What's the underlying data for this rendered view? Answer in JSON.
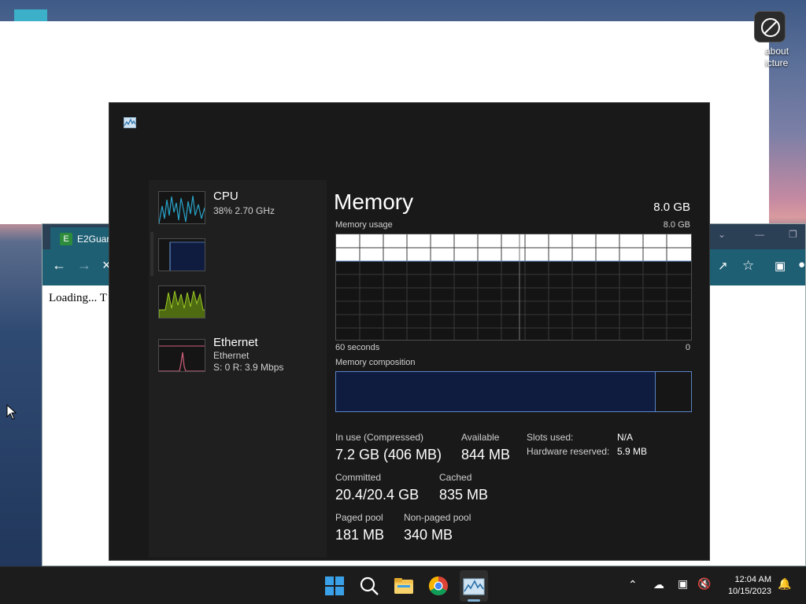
{
  "desktop": {
    "icon_label": "about\nicture"
  },
  "edge": {
    "tab_title": "E2Guar",
    "content_text": "Loading... T"
  },
  "task_manager": {
    "sidebar": [
      {
        "title": "CPU",
        "subtitle": "38% 2.70 GHz"
      },
      {
        "title": "",
        "subtitle": ""
      },
      {
        "title": "",
        "subtitle": ""
      },
      {
        "title": "Ethernet",
        "subtitle": "Ethernet",
        "subtitle2": "S: 0 R: 3.9 Mbps"
      }
    ],
    "heading": "Memory",
    "total": "8.0 GB",
    "usage_label": "Memory usage",
    "usage_max": "8.0 GB",
    "time_left": "60 seconds",
    "time_right": "0",
    "composition_label": "Memory composition",
    "composition_inuse_fraction": 0.9,
    "stats": {
      "in_use_label": "In use (Compressed)",
      "in_use_value": "7.2 GB (406 MB)",
      "available_label": "Available",
      "available_value": "844 MB",
      "committed_label": "Committed",
      "committed_value": "20.4/20.4 GB",
      "cached_label": "Cached",
      "cached_value": "835 MB",
      "paged_label": "Paged pool",
      "paged_value": "181 MB",
      "nonpaged_label": "Non-paged pool",
      "nonpaged_value": "340 MB",
      "slots_label": "Slots used:",
      "slots_value": "N/A",
      "hw_label": "Hardware reserved:",
      "hw_value": "5.9 MB"
    }
  },
  "taskbar": {
    "time": "12:04 AM",
    "date": "10/15/2023"
  },
  "colors": {
    "accent": "#5a83c6",
    "cpu_graph": "#29a3c9",
    "memory_graph": "#0f1c3f",
    "gpu_graph": "#9ccb24",
    "ethernet_graph": "#d0607a"
  }
}
